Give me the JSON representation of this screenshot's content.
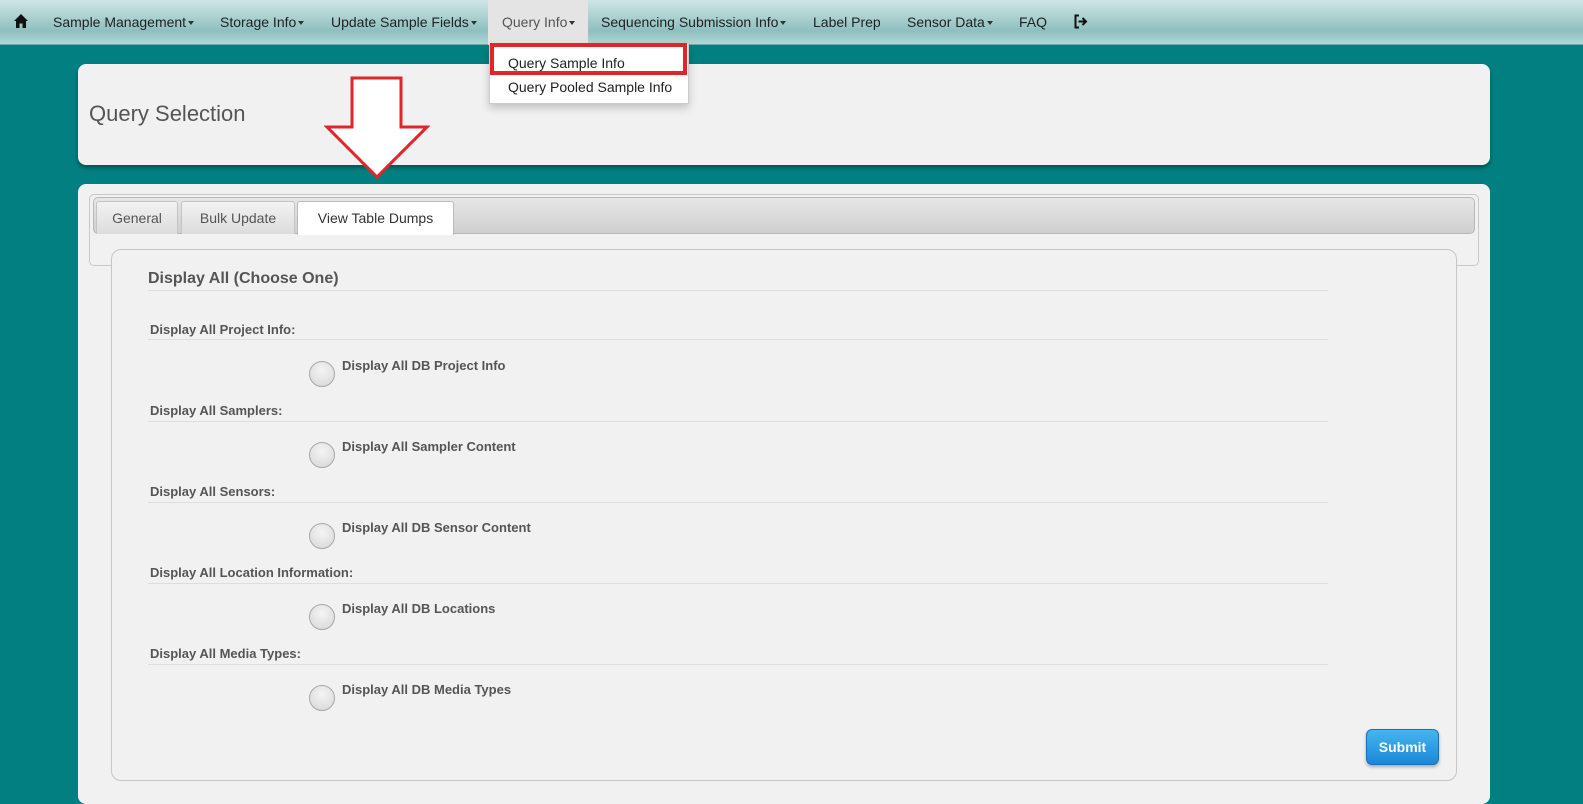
{
  "navbar": {
    "home_icon": "home-icon",
    "items": [
      {
        "label": "Sample Management",
        "dropdown": true
      },
      {
        "label": "Storage Info",
        "dropdown": true
      },
      {
        "label": "Update Sample Fields",
        "dropdown": true
      },
      {
        "label": "Query Info",
        "dropdown": true,
        "active": true
      },
      {
        "label": "Sequencing Submission Info",
        "dropdown": true
      },
      {
        "label": "Label Prep",
        "dropdown": false
      },
      {
        "label": "Sensor Data",
        "dropdown": true
      },
      {
        "label": "FAQ",
        "dropdown": false
      }
    ],
    "logout_icon": "logout-icon"
  },
  "dropdown": {
    "items": [
      "Query Sample Info",
      "Query Pooled Sample Info"
    ],
    "highlighted": "Query Sample Info",
    "highlight_color": "#e2252b"
  },
  "header_panel": {
    "title": "Query Selection"
  },
  "tabs": [
    {
      "label": "General"
    },
    {
      "label": "Bulk Update"
    },
    {
      "label": "View Table Dumps",
      "active": true
    }
  ],
  "form": {
    "heading": "Display All (Choose One)",
    "groups": [
      {
        "label": "Display All Project Info:",
        "option": "Display All DB Project Info"
      },
      {
        "label": "Display All Samplers:",
        "option": "Display All Sampler Content"
      },
      {
        "label": "Display All Sensors:",
        "option": "Display All DB Sensor Content"
      },
      {
        "label": "Display All Location Information:",
        "option": "Display All DB Locations"
      },
      {
        "label": "Display All Media Types:",
        "option": "Display All DB Media Types"
      }
    ],
    "submit_label": "Submit"
  },
  "colors": {
    "background": "#028081",
    "submit": "#1b87d8",
    "annotation_arrow": "#e2252b"
  }
}
